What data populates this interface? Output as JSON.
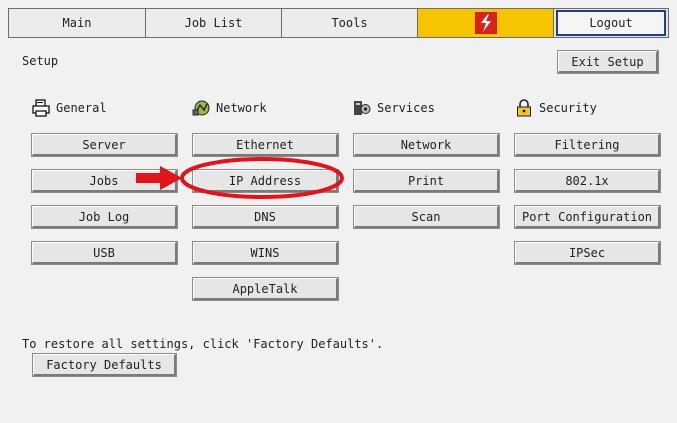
{
  "tabs": {
    "main": "Main",
    "job_list": "Job List",
    "tools": "Tools",
    "logout": "Logout"
  },
  "setup": {
    "title": "Setup",
    "exit_button": "Exit Setup"
  },
  "columns": {
    "general": {
      "heading": "General",
      "icon": "printer-icon",
      "buttons": [
        "Server",
        "Jobs",
        "Job Log",
        "USB"
      ]
    },
    "network": {
      "heading": "Network",
      "icon": "network-icon",
      "buttons": [
        "Ethernet",
        "IP Address",
        "DNS",
        "WINS",
        "AppleTalk"
      ]
    },
    "services": {
      "heading": "Services",
      "icon": "services-icon",
      "buttons": [
        "Network",
        "Print",
        "Scan"
      ]
    },
    "security": {
      "heading": "Security",
      "icon": "lock-icon",
      "buttons": [
        "Filtering",
        "802.1x",
        "Port Configuration",
        "IPSec"
      ]
    }
  },
  "footer": {
    "restore_message": "To restore all settings, click 'Factory Defaults'.",
    "factory_defaults_button": "Factory Defaults"
  },
  "colors": {
    "fiery_tab": "#f6c400",
    "highlight_red": "#e2141b",
    "logout_border": "#203e8c"
  }
}
